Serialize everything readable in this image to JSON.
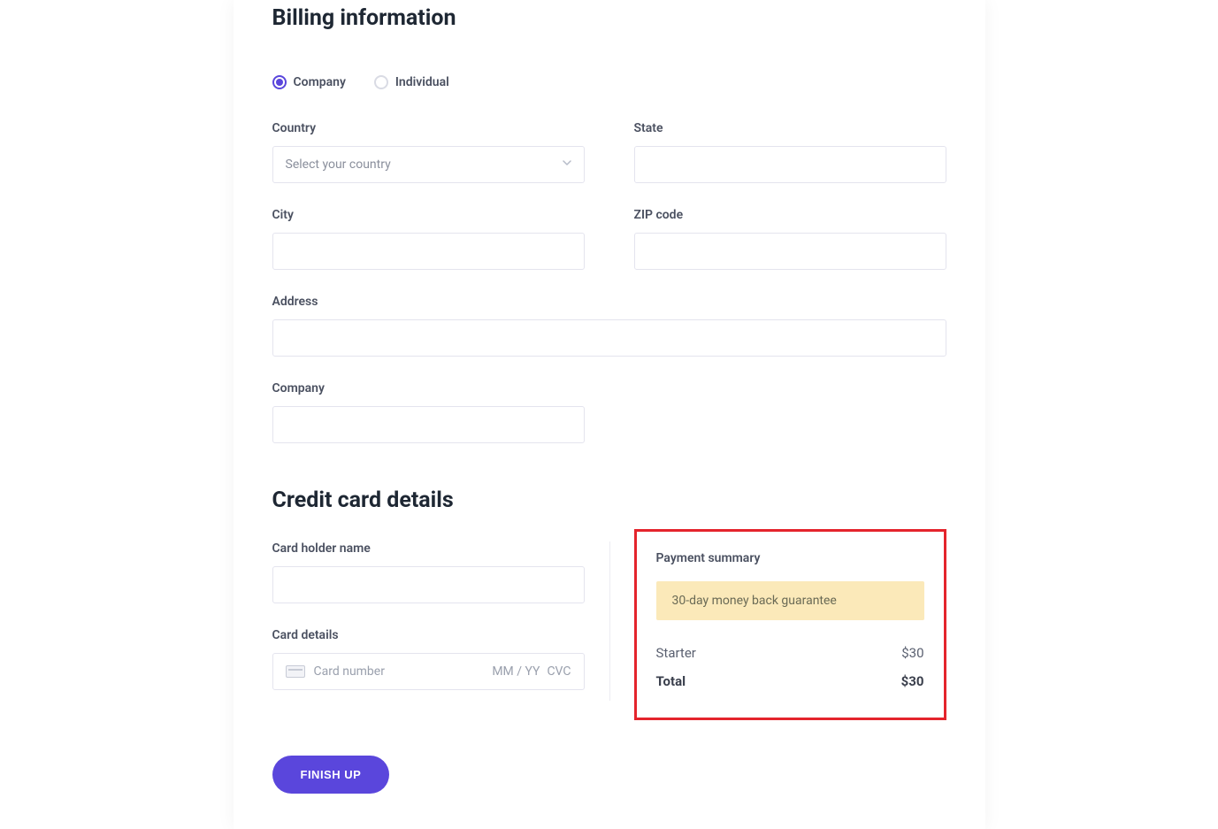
{
  "billing": {
    "title": "Billing information",
    "radios": {
      "company": "Company",
      "individual": "Individual"
    },
    "labels": {
      "country": "Country",
      "state": "State",
      "city": "City",
      "zip": "ZIP code",
      "address": "Address",
      "company": "Company"
    },
    "country_placeholder": "Select your country"
  },
  "credit": {
    "title": "Credit card details",
    "labels": {
      "holder": "Card holder name",
      "details": "Card details"
    },
    "card_placeholders": {
      "number": "Card number",
      "exp": "MM / YY",
      "cvc": "CVC"
    }
  },
  "summary": {
    "heading": "Payment summary",
    "guarantee": "30-day money back guarantee",
    "lines": {
      "plan_name": "Starter",
      "plan_price": "$30",
      "total_label": "Total",
      "total_price": "$30"
    }
  },
  "actions": {
    "finish": "FINISH UP"
  }
}
